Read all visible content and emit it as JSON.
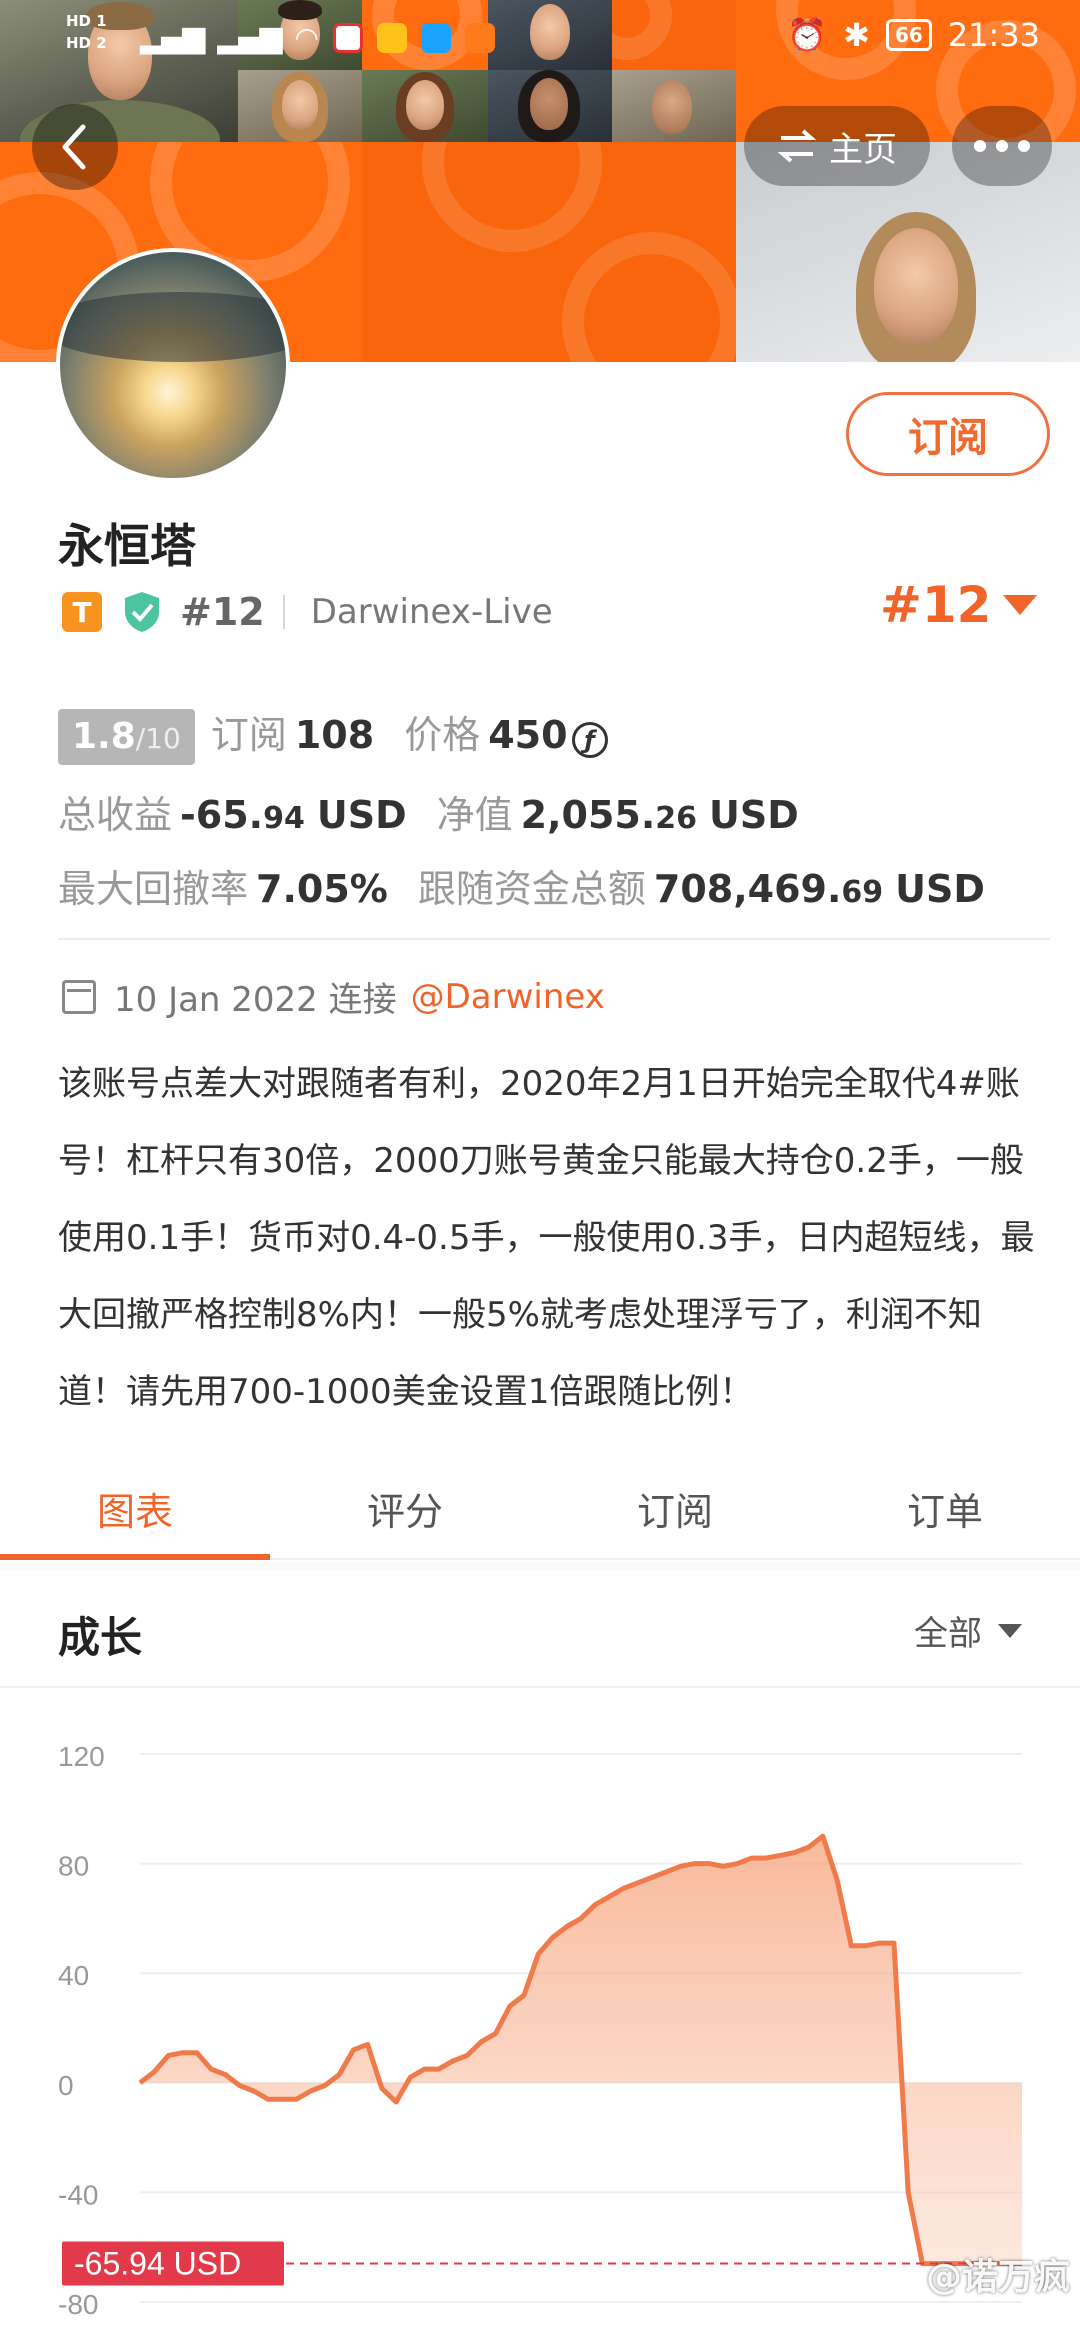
{
  "status_bar": {
    "sim1": "HD 1",
    "sim2": "HD 2",
    "battery": "66",
    "time": "21:33"
  },
  "header": {
    "home_label": "主页"
  },
  "profile": {
    "subscribe_label": "订阅",
    "name": "永恒塔",
    "tier_badge": "T",
    "rank_small": "#12",
    "server": "Darwinex-Live",
    "rank_big": "#12"
  },
  "stats": {
    "score": "1.8",
    "score_max": "/10",
    "subscriptions_label": "订阅",
    "subscriptions": "108",
    "price_label": "价格",
    "price": "450",
    "price_unit": "ƒ",
    "total_profit_label": "总收益",
    "total_profit_int": "-65.",
    "total_profit_dec": "94",
    "total_profit_unit": "USD",
    "equity_label": "净值",
    "equity_int": "2,055.",
    "equity_dec": "26",
    "equity_unit": "USD",
    "max_drawdown_label": "最大回撤率",
    "max_drawdown": "7.05%",
    "follow_funds_label": "跟随资金总额",
    "follow_funds_int": "708,469.",
    "follow_funds_dec": "69",
    "follow_funds_unit": "USD"
  },
  "since": {
    "date": "10 Jan 2022 连接",
    "source": "@Darwinex"
  },
  "description": "该账号点差大对跟随者有利，2020年2月1日开始完全取代4#账号！杠杆只有30倍，2000刀账号黄金只能最大持仓0.2手，一般使用0.1手！货币对0.4-0.5手，一般使用0.3手，日内超短线，最大回撤严格控制8%内！一般5%就考虑处理浮亏了，利润不知道！请先用700-1000美金设置1倍跟随比例！",
  "tabs": [
    "图表",
    "评分",
    "订阅",
    "订单"
  ],
  "chart_section": {
    "title": "成长",
    "range": "全部"
  },
  "watermark": "@诺万疯",
  "colors": {
    "accent": "#f0642a",
    "line": "#f07a4a",
    "marker": "#e23a4a"
  },
  "chart_data": {
    "type": "area",
    "title": "",
    "xlabel": "",
    "ylabel": "",
    "ylim": [
      -80,
      120
    ],
    "yticks": [
      120,
      80,
      40,
      0,
      -40,
      -80
    ],
    "grid": true,
    "current_value_label": "-65.94 USD",
    "current_value": -65.94,
    "x": [
      0,
      1,
      2,
      3,
      4,
      5,
      6,
      7,
      8,
      9,
      10,
      11,
      12,
      13,
      14,
      15,
      16,
      17,
      18,
      19,
      20,
      21,
      22,
      23,
      24,
      25,
      26,
      27,
      28,
      29,
      30,
      31,
      32,
      33,
      34,
      35,
      36,
      37,
      38,
      39,
      40,
      41,
      42,
      43,
      44,
      45,
      46,
      47,
      48,
      49,
      50,
      51,
      52,
      53,
      54,
      55,
      56,
      57,
      58,
      59,
      60,
      61,
      62
    ],
    "y": [
      0,
      4,
      10,
      11,
      11,
      5,
      3,
      -1,
      -3,
      -6,
      -6,
      -6,
      -3,
      -1,
      3,
      12,
      14,
      -2,
      -7,
      2,
      5,
      5,
      8,
      10,
      15,
      18,
      28,
      32,
      47,
      53,
      57,
      60,
      65,
      68,
      71,
      73,
      75,
      77,
      79,
      80,
      80,
      79,
      80,
      82,
      82,
      83,
      84,
      86,
      90,
      74,
      50,
      50,
      51,
      51,
      -40,
      -66,
      -66,
      -66,
      -66,
      -66,
      -66,
      -66,
      -66
    ]
  }
}
